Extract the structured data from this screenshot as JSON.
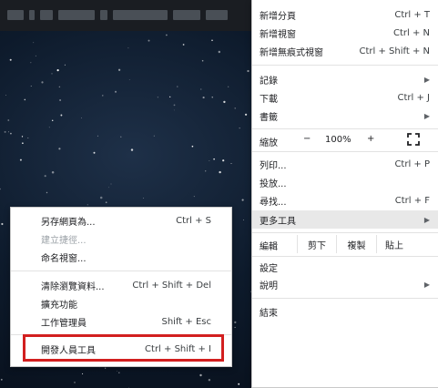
{
  "main_menu": {
    "new_tab": {
      "label": "新增分頁",
      "shortcut": "Ctrl + T"
    },
    "new_window": {
      "label": "新增視窗",
      "shortcut": "Ctrl + N"
    },
    "new_incognito": {
      "label": "新增無痕式視窗",
      "shortcut": "Ctrl + Shift + N"
    },
    "history": {
      "label": "記錄"
    },
    "downloads": {
      "label": "下載",
      "shortcut": "Ctrl + J"
    },
    "bookmarks": {
      "label": "書籤"
    },
    "zoom": {
      "label": "縮放",
      "minus": "−",
      "value": "100%",
      "plus": "+"
    },
    "print": {
      "label": "列印...",
      "shortcut": "Ctrl + P"
    },
    "cast": {
      "label": "投放..."
    },
    "find": {
      "label": "尋找...",
      "shortcut": "Ctrl + F"
    },
    "more_tools": {
      "label": "更多工具"
    },
    "edit": {
      "label": "編輯",
      "cut": "剪下",
      "copy": "複製",
      "paste": "貼上"
    },
    "settings": {
      "label": "設定"
    },
    "help": {
      "label": "說明"
    },
    "exit": {
      "label": "結束"
    }
  },
  "sub_menu": {
    "save_page": {
      "label": "另存網頁為...",
      "shortcut": "Ctrl + S"
    },
    "create_shortcut": {
      "label": "建立捷徑..."
    },
    "name_window": {
      "label": "命名視窗..."
    },
    "clear_data": {
      "label": "清除瀏覽資料...",
      "shortcut": "Ctrl + Shift + Del"
    },
    "extensions": {
      "label": "擴充功能"
    },
    "task_manager": {
      "label": "工作管理員",
      "shortcut": "Shift + Esc"
    },
    "dev_tools": {
      "label": "開發人員工具",
      "shortcut": "Ctrl + Shift + I"
    }
  },
  "colors": {
    "highlight_box": "#d21f1f",
    "menu_bg": "#ffffff",
    "hover_bg": "#e8e8e8"
  }
}
